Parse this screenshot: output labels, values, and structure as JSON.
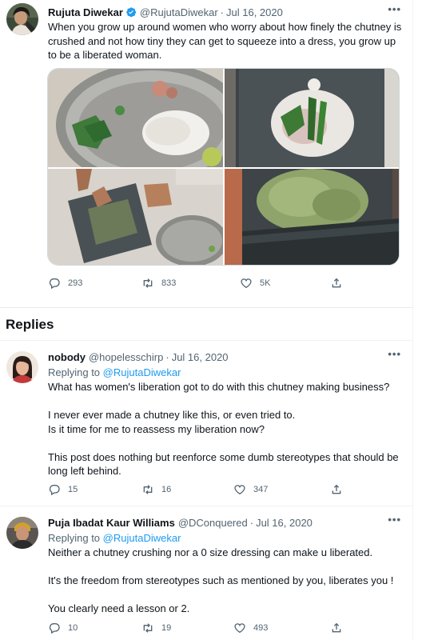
{
  "main_tweet": {
    "name": "Rujuta Diwekar",
    "handle": "@RujutaDiwekar",
    "date": "Jul 16, 2020",
    "text": "When you grow up around women who worry about how finely the chutney is crushed and not how tiny they can get to squeeze into a dress, you grow up to be a liberated woman.",
    "more": "•••",
    "replies_count": "293",
    "retweets_count": "833",
    "likes_count": "5K",
    "verified_color": "#1d9bf0"
  },
  "replies_section": {
    "heading": "Replies"
  },
  "replies": [
    {
      "name": "nobody",
      "handle": "@hopelesschirp",
      "date": "Jul 16, 2020",
      "more": "•••",
      "replying_prefix": "Replying to",
      "replying_to": "@RujutaDiwekar",
      "paragraphs": [
        "What has women's liberation got to do with this chutney making business?",
        "I never ever made a chutney like this, or even tried to.",
        "Is it time for me to reassess my liberation now?",
        "This post does nothing but reenforce some dumb stereotypes that should be long left behind."
      ],
      "replies_count": "15",
      "retweets_count": "16",
      "likes_count": "347"
    },
    {
      "name": "Puja Ibadat Kaur Williams",
      "handle": "@DConquered",
      "date": "Jul 16, 2020",
      "more": "•••",
      "replying_prefix": "Replying to",
      "replying_to": "@RujutaDiwekar",
      "paragraphs": [
        "Neither a chutney crushing nor a 0 size dressing can make u liberated.",
        "It's the freedom from stereotypes such as mentioned by you, liberates you !",
        "You clearly need a lesson or 2."
      ],
      "replies_count": "10",
      "retweets_count": "19",
      "likes_count": "493"
    }
  ],
  "icons": {
    "reply": "reply-icon",
    "retweet": "retweet-icon",
    "like": "heart-icon",
    "share": "share-icon",
    "verified": "verified-badge-icon"
  }
}
